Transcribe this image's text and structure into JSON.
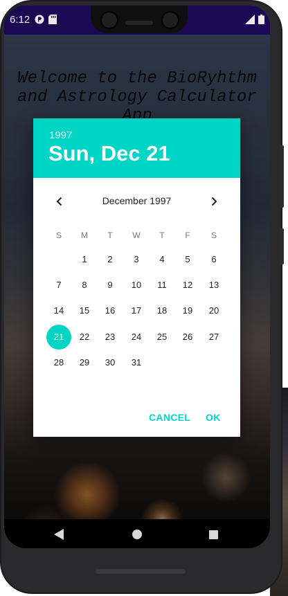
{
  "status_bar": {
    "time": "6:12"
  },
  "app": {
    "welcome_line1": "Welcome to the BioRyhthm",
    "welcome_line2": "and Astrology Calculator",
    "welcome_line3": "App"
  },
  "date_picker": {
    "header_year": "1997",
    "header_date": "Sun, Dec 21",
    "month_label": "December 1997",
    "weekdays": [
      "S",
      "M",
      "T",
      "W",
      "T",
      "F",
      "S"
    ],
    "first_weekday_index": 1,
    "days_in_month": 31,
    "selected_day": 21,
    "cancel_label": "CANCEL",
    "ok_label": "OK",
    "accent_color": "#00d5c5"
  },
  "nav_bar": {
    "back": "back-icon",
    "home": "home-icon",
    "recents": "recents-icon"
  }
}
